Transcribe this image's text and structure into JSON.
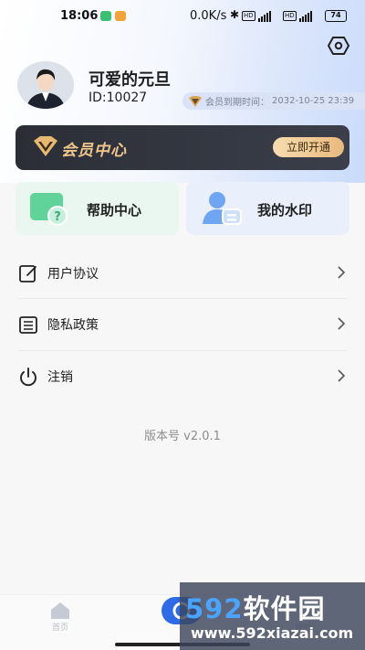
{
  "status_bar": {
    "time": "18:06",
    "network_speed": "0.0K/s",
    "bluetooth_icon": "bluetooth-icon",
    "sim_tags": [
      "HD 4G",
      "HD 4G"
    ],
    "battery": "74"
  },
  "header": {
    "settings_icon": "hexagon-settings-icon"
  },
  "profile": {
    "name": "可爱的元旦",
    "id_text": "ID:10027",
    "expire_label": "会员到期时间：",
    "expire_date": "2032-10-25 23:39"
  },
  "vip": {
    "title": "会员中心",
    "button": "立即开通",
    "accent_color": "#efc78b"
  },
  "cards": {
    "help": "帮助中心",
    "watermark": "我的水印"
  },
  "menu": {
    "agreement": "用户协议",
    "privacy": "隐私政策",
    "logout": "注销"
  },
  "version": "版本号 v2.0.1",
  "tabbar": {
    "home": "首页",
    "mine": "我的"
  },
  "overlay_watermark": {
    "number": "592",
    "brand": "软件园",
    "url": "www.592xiazai.com"
  }
}
